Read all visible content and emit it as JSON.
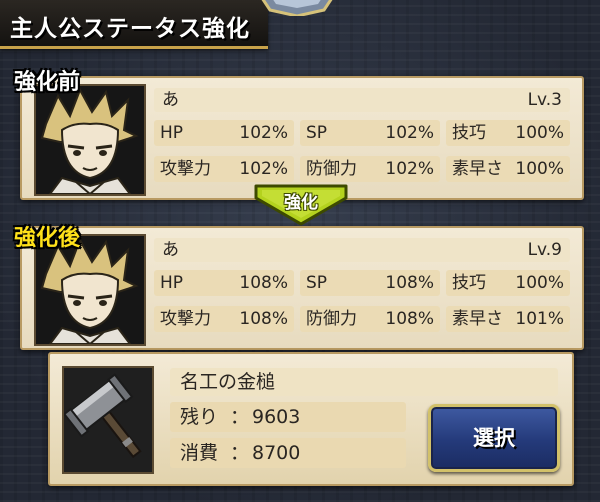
{
  "header": {
    "title": "主人公ステータス強化"
  },
  "before": {
    "label": "強化前",
    "name": "あ",
    "level": "Lv.3",
    "stats": [
      {
        "label": "HP",
        "value": "102%"
      },
      {
        "label": "SP",
        "value": "102%"
      },
      {
        "label": "技巧",
        "value": "100%"
      },
      {
        "label": "攻撃力",
        "value": "102%"
      },
      {
        "label": "防御力",
        "value": "102%"
      },
      {
        "label": "素早さ",
        "value": "100%"
      }
    ]
  },
  "arrow": {
    "label": "強化"
  },
  "after": {
    "label": "強化後",
    "name": "あ",
    "level": "Lv.9",
    "stats": [
      {
        "label": "HP",
        "value": "108%"
      },
      {
        "label": "SP",
        "value": "108%"
      },
      {
        "label": "技巧",
        "value": "100%"
      },
      {
        "label": "攻撃力",
        "value": "108%"
      },
      {
        "label": "防御力",
        "value": "108%"
      },
      {
        "label": "素早さ",
        "value": "101%"
      }
    ]
  },
  "item": {
    "name": "名工の金槌",
    "remaining_label": "残り",
    "remaining_value": "9603",
    "cost_label": "消費",
    "cost_value": "8700",
    "colon": "：",
    "icon": "hammer-icon",
    "select_label": "選択"
  },
  "colors": {
    "label_after": "#ffe11a",
    "button": "#243a7a",
    "button_border": "#d2c16a",
    "arrow": "#b4d21e"
  }
}
